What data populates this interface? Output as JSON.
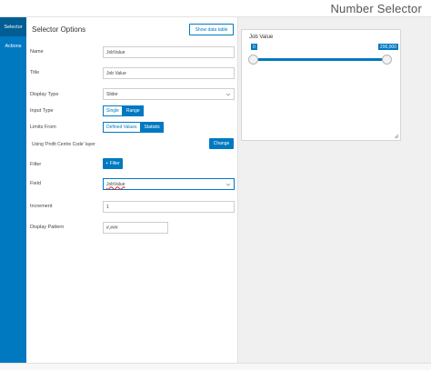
{
  "app": {
    "title": "Number Selector"
  },
  "side_nav": {
    "items": [
      {
        "label": "Selector",
        "active": true
      },
      {
        "label": "Actions",
        "active": false
      }
    ]
  },
  "panel": {
    "title": "Selector Options",
    "show_data_table": "Show data table",
    "name": {
      "label": "Name",
      "value": "JobValue"
    },
    "title_field": {
      "label": "Title",
      "value": "Job Value"
    },
    "display_type": {
      "label": "Display Type",
      "value": "Slider"
    },
    "input_type": {
      "label": "Input Type",
      "options": [
        "Single",
        "Range"
      ],
      "selected": "Range"
    },
    "limits_from": {
      "label": "Limits From",
      "options": [
        "Defined Values",
        "Statistic"
      ],
      "selected": "Statistic"
    },
    "layer_text": "Using 'Profit Centre Code' layer",
    "change_label": "Change",
    "filter": {
      "label": "Filter",
      "button": "+ Filter"
    },
    "field": {
      "label": "Field",
      "value": "JobValue"
    },
    "increment": {
      "label": "Increment",
      "value": "1"
    },
    "display_pattern": {
      "label": "Display Pattern",
      "value": "#,###"
    }
  },
  "preview": {
    "title": "Job Value",
    "min": "0",
    "max": "200,000",
    "range_start": 0,
    "range_end": 200000
  },
  "colors": {
    "accent": "#0079c1",
    "nav_active": "#005e95"
  }
}
